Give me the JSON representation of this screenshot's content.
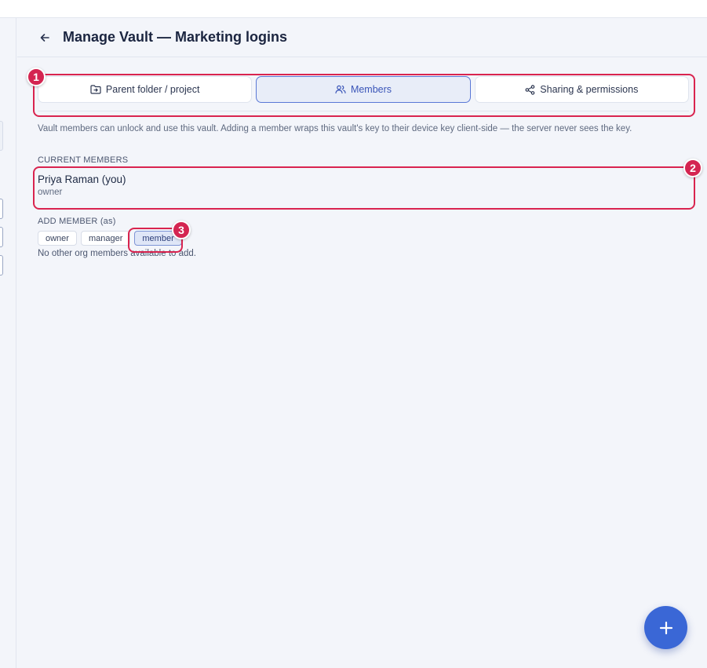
{
  "header": {
    "back_icon": "arrow-left-icon",
    "title": "Manage Vault — Marketing logins"
  },
  "tabs": [
    {
      "label": "Parent folder / project",
      "icon": "folder-move-icon",
      "active": false
    },
    {
      "label": "Members",
      "icon": "users-icon",
      "active": true
    },
    {
      "label": "Sharing & permissions",
      "icon": "share-icon",
      "active": false
    }
  ],
  "description": "Vault members can unlock and use this vault. Adding a member wraps this vault's key to their device key client-side — the server never sees the key.",
  "current_members": {
    "label": "CURRENT MEMBERS",
    "items": [
      {
        "name": "Priya Raman (you)",
        "role": "owner"
      }
    ]
  },
  "add_member": {
    "label": "ADD MEMBER (as)",
    "roles": [
      "owner",
      "manager",
      "member"
    ],
    "selected_role": "member",
    "empty_message": "No other org members available to add."
  },
  "annotations": [
    "1",
    "2",
    "3"
  ],
  "fab": {
    "icon": "plus-icon"
  },
  "colors": {
    "accent": "#3a67d6",
    "annotation": "#d9244f",
    "background": "#f3f5fa"
  }
}
